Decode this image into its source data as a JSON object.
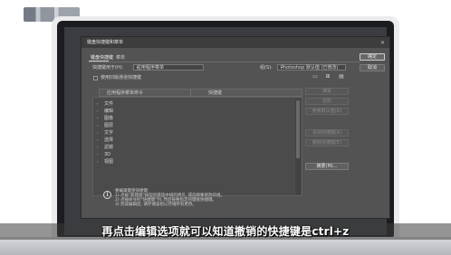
{
  "dialog": {
    "title": "键盘快捷键和菜单",
    "tabs": [
      {
        "label": "键盘快捷键",
        "active": true
      },
      {
        "label": "菜单",
        "active": false
      }
    ],
    "shortcuts_for_label": "快捷键用于(H):",
    "shortcuts_for_value": "应用程序菜单",
    "set_label": "组(S):",
    "set_value": "Photoshop 默认值 (已修改)",
    "checkbox_label": "使用旧版通道快捷键",
    "columns": [
      "应用程序菜单命令",
      "快捷键"
    ],
    "menu_items": [
      "文件",
      "编辑",
      "图像",
      "图层",
      "文字",
      "选择",
      "滤镜",
      "3D",
      "视图"
    ],
    "buttons": {
      "ok": "确定",
      "cancel": "取消",
      "accept": "接受",
      "undo": "还原",
      "use_default": "使用默认值(D)",
      "add_shortcut": "添加快捷键(A)",
      "delete_shortcut": "删除快捷键(E)",
      "summarize": "摘要(M)..."
    },
    "notes": [
      "要编辑键盘快捷键:",
      "1) 点按\"新建组\"按钮创建选中组的拷贝, 或选择要修改的组。",
      "2) 点按命令的\"快捷键\"列, 然后按要指定的键盘快捷键。",
      "3) 完成编辑后, 请存储该组以存储所有更改。"
    ]
  },
  "subtitle": "再点击编辑选项就可以知道撤销的快捷键是ctrl+z",
  "colors": {
    "dialog_bg": "#535353",
    "screen_bg": "#3b3c3f",
    "subtitle_text": "#ffffff"
  }
}
